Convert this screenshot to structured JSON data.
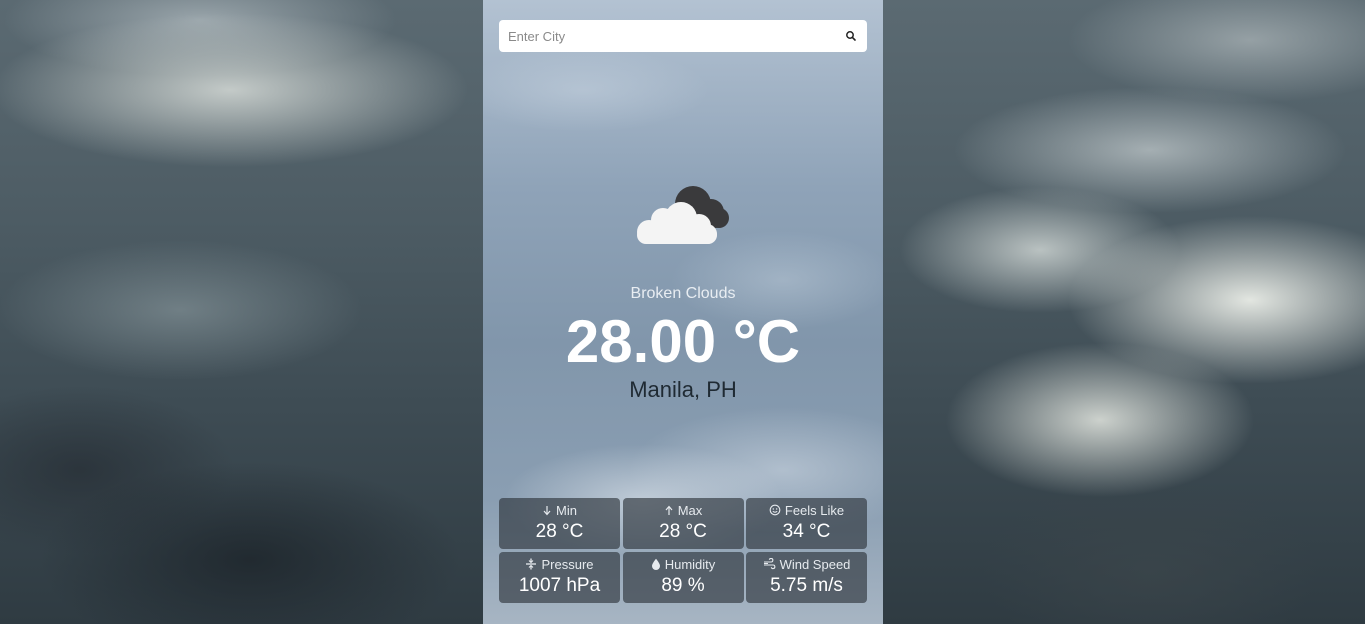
{
  "search": {
    "placeholder": "Enter City",
    "value": "",
    "button_icon": "search-icon"
  },
  "weather": {
    "icon": "broken-clouds-icon",
    "condition": "Broken Clouds",
    "temperature": "28.00 °C",
    "location": "Manila, PH"
  },
  "stats": [
    {
      "label": "Min",
      "value": "28 °C",
      "icon": "arrow-down-icon"
    },
    {
      "label": "Max",
      "value": "28 °C",
      "icon": "arrow-up-icon"
    },
    {
      "label": "Feels Like",
      "value": "34 °C",
      "icon": "smiley-icon"
    },
    {
      "label": "Pressure",
      "value": "1007 hPa",
      "icon": "pressure-icon"
    },
    {
      "label": "Humidity",
      "value": "89 %",
      "icon": "droplet-icon"
    },
    {
      "label": "Wind Speed",
      "value": "5.75 m/s",
      "icon": "wind-icon"
    }
  ],
  "colors": {
    "panel": "#8fa3b8",
    "stat_box": "#2e343c",
    "temperature_text": "#ffffff",
    "location_text": "#1f2a33"
  }
}
